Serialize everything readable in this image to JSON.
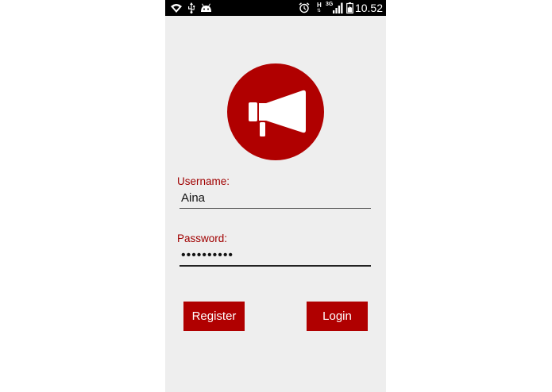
{
  "status_bar": {
    "time": "10.52",
    "icons": [
      "wifi-icon",
      "usb-icon",
      "android-icon",
      "alarm-icon",
      "h-network-icon",
      "3g-network-icon",
      "signal-icon",
      "battery-icon"
    ],
    "network_h": "H",
    "network_3g": "3G"
  },
  "logo": {
    "icon": "megaphone-icon",
    "background_color": "#b00000"
  },
  "form": {
    "username_label": "Username:",
    "username_value": "Aina",
    "password_label": "Password:",
    "password_value": "aaaaaaaaaa"
  },
  "buttons": {
    "register_label": "Register",
    "login_label": "Login"
  },
  "colors": {
    "accent": "#b00000",
    "label": "#a00000",
    "background": "#eeeeee",
    "status_bar": "#000000"
  }
}
